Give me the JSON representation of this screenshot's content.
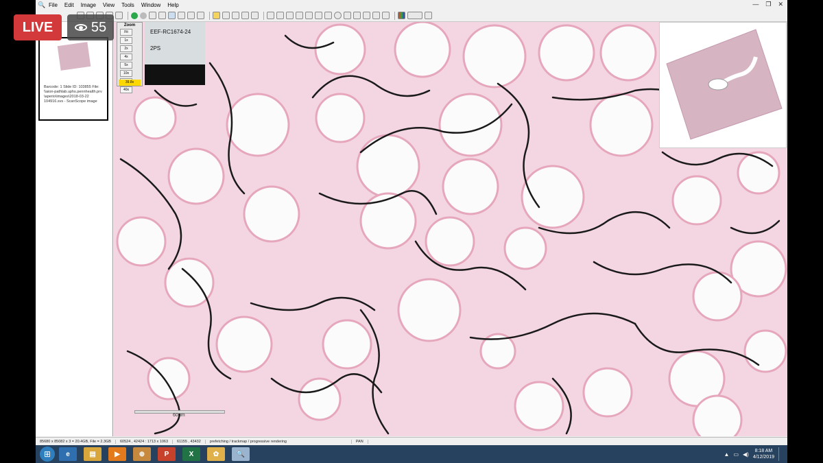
{
  "menu": [
    "File",
    "Edit",
    "Image",
    "View",
    "Tools",
    "Window",
    "Help"
  ],
  "live_label": "LIVE",
  "viewer_count": "55",
  "thumbnail": {
    "caption": "Barcode: 1   Slide ID: 103855 File: \\\\aion-pathlab.uphs.pennhealth.prv \\aperio\\images\\2018-03-22 104916.svs - ScanScope image"
  },
  "zoom": {
    "title": "Zoom",
    "levels": [
      "Fit",
      "1x",
      "2x",
      "4x",
      "5x",
      "10x",
      "20x",
      "40x"
    ],
    "current": "39.8x"
  },
  "slide_label": {
    "line1": "EEF-RC1674-24",
    "line2": "2PS"
  },
  "scalebar_label": "60μm",
  "statusbar": [
    "85680 x 85082 x 3 = 20.4GB, File = 2.3GB",
    "60524 , 42424 : 1713 x 1063",
    "61155 , 43432",
    "prefetching / trackmap / progressive rendering",
    "PAN"
  ],
  "taskbar": {
    "apps": [
      "ie-icon",
      "explorer-icon",
      "media-player-icon",
      "network-icon",
      "powerpoint-icon",
      "excel-icon",
      "chrome-like-icon",
      "imagescope-icon"
    ],
    "time": "8:18 AM",
    "date": "4/12/2019"
  },
  "colors": {
    "live": "#d3393b",
    "stain_pink": "#e6a7bd",
    "reticulin": "#1a1a1a",
    "taskbar": "#27425e"
  }
}
